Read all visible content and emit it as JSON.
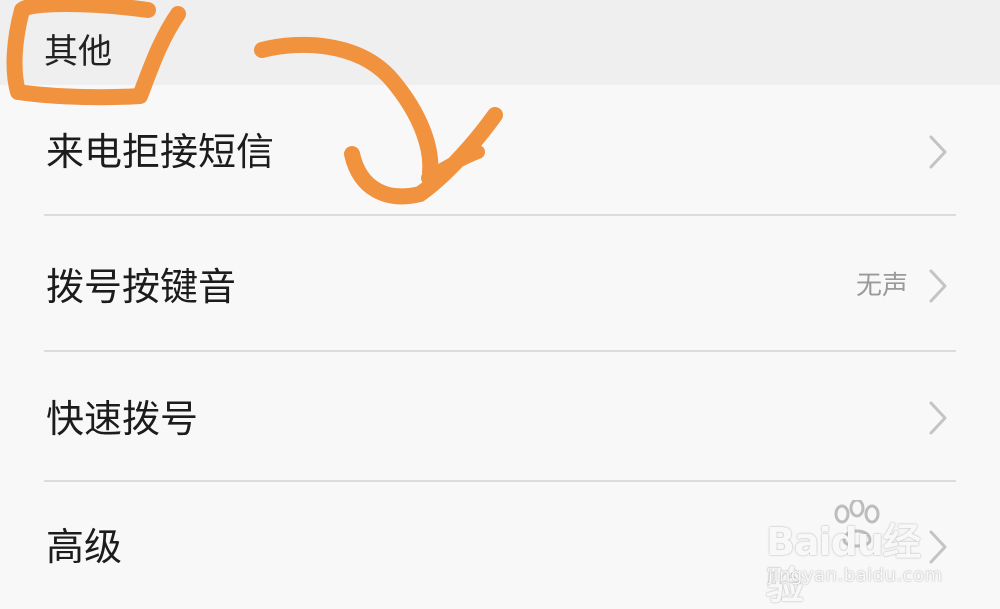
{
  "section": {
    "title": "其他"
  },
  "rows": [
    {
      "label": "来电拒接短信",
      "value": ""
    },
    {
      "label": "拨号按键音",
      "value": "无声"
    },
    {
      "label": "快速拨号",
      "value": ""
    },
    {
      "label": "高级",
      "value": ""
    }
  ],
  "icons": {
    "chevron": "chevron-right-icon"
  },
  "colors": {
    "annotation": "#f0923e",
    "header_bg": "#efefef",
    "list_bg": "#f8f8f8",
    "divider": "#dcdcdc",
    "value_text": "#9a9a9a",
    "chevron": "#c4c4c4"
  },
  "watermark": {
    "brand": "Baidu经验",
    "url": "jingyan.baidu.com"
  }
}
